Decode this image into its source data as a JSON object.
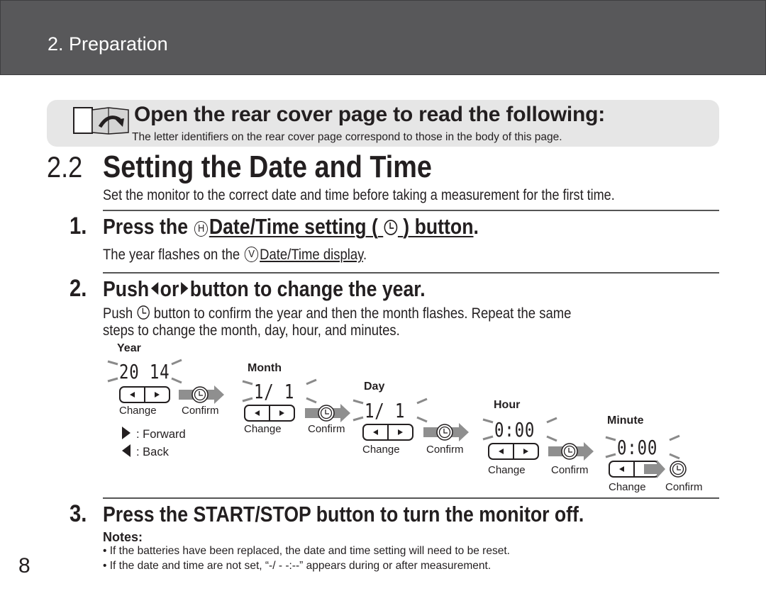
{
  "header": {
    "chapter": "2. Preparation"
  },
  "callout": {
    "icon": "open-book-icon",
    "title": "Open the rear cover page to read the following:",
    "subtitle": "The letter identifiers on the rear cover page correspond to those in the body of this page."
  },
  "section": {
    "number": "2.2",
    "title": "Setting the Date and Time",
    "intro": "Set the monitor to the correct date and time before taking a measurement for the first time."
  },
  "steps": [
    {
      "number": "1.",
      "title_prefix": "Press the",
      "title_letter": "H",
      "title_link": "Date/Time setting (",
      "title_link_end": ") button",
      "title_suffix": ".",
      "body_prefix": "The year flashes on the",
      "body_letter": "V",
      "body_link": "Date/Time display",
      "body_suffix": "."
    },
    {
      "number": "2.",
      "title_prefix": "Push",
      "title_mid": "or",
      "title_suffix": "button to change the year.",
      "body_prefix": "Push",
      "body_line1": "button to confirm the year and then the month flashes. Repeat the same",
      "body_line2": "steps to change the month, day, hour, and minutes."
    },
    {
      "number": "3.",
      "title": "Press the START/STOP button to turn the monitor off."
    }
  ],
  "diagram": {
    "stages": [
      {
        "label": "Year",
        "display": "20 14",
        "change": "Change",
        "confirm": "Confirm"
      },
      {
        "label": "Month",
        "display": "1/ 1",
        "change": "Change",
        "confirm": "Confirm"
      },
      {
        "label": "Day",
        "display": "1/ 1",
        "change": "Change",
        "confirm": "Confirm"
      },
      {
        "label": "Hour",
        "display": "0:00",
        "change": "Change",
        "confirm": "Confirm"
      },
      {
        "label": "Minute",
        "display": "0:00",
        "change": "Change",
        "confirm": "Confirm"
      }
    ],
    "legend": {
      "forward": ": Forward",
      "back": ": Back"
    }
  },
  "notes": {
    "label": "Notes:",
    "items": [
      "• If the batteries have been replaced, the date and time setting will need to be reset.",
      "• If the date and time are not set, “-/ -  -:--” appears during or after measurement."
    ]
  },
  "page_number": "8"
}
